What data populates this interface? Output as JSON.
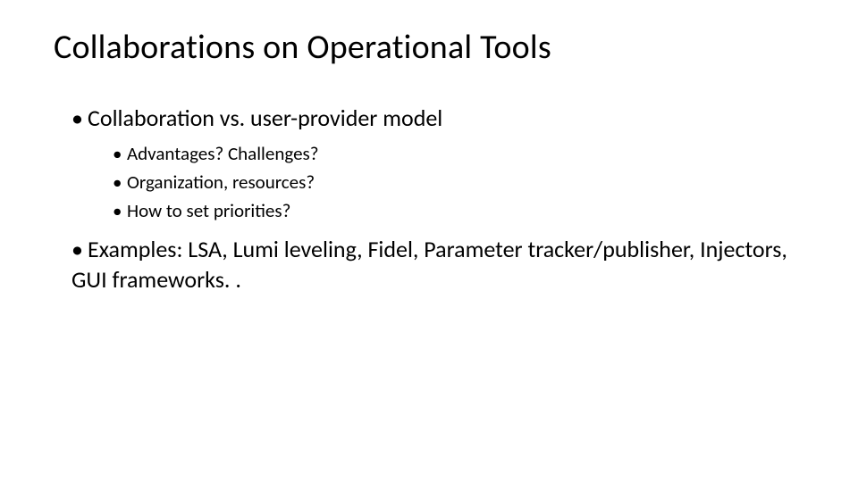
{
  "title": "Collaborations on Operational Tools",
  "bullets": [
    {
      "text": "Collaboration vs. user-provider model",
      "sub": [
        "Advantages? Challenges?",
        "Organization, resources?",
        "How to set priorities?"
      ]
    },
    {
      "text": "Examples: LSA, Lumi leveling, Fidel, Parameter tracker/publisher, Injectors, GUI frameworks. .",
      "sub": []
    }
  ]
}
